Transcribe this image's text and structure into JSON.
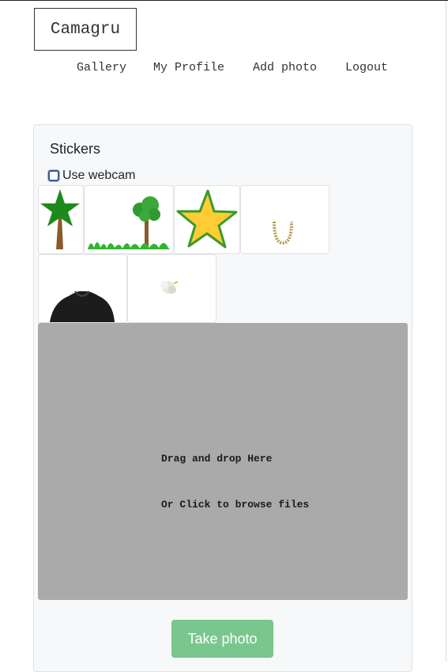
{
  "header": {
    "logo_text": "Camagru"
  },
  "nav": {
    "items": [
      "Gallery",
      "My Profile",
      "Add photo",
      "Logout"
    ]
  },
  "stickers_panel": {
    "title": "Stickers",
    "webcam_label": "Use webcam",
    "webcam_checked": false,
    "stickers": [
      {
        "icon": "tree-icon"
      },
      {
        "icon": "tree-grass-icon"
      },
      {
        "icon": "star-icon"
      },
      {
        "icon": "chain-necklace-icon"
      },
      {
        "icon": "black-cape-icon"
      },
      {
        "icon": "cotton-ball-icon"
      }
    ],
    "dropzone": {
      "line1": "Drag and drop Here",
      "line2": "Or Click to browse files"
    },
    "take_photo_label": "Take photo"
  },
  "colors": {
    "card_bg": "#f7f8fa",
    "dropzone_bg": "#aaaaaa",
    "take_photo_bg": "#7ac68f"
  }
}
